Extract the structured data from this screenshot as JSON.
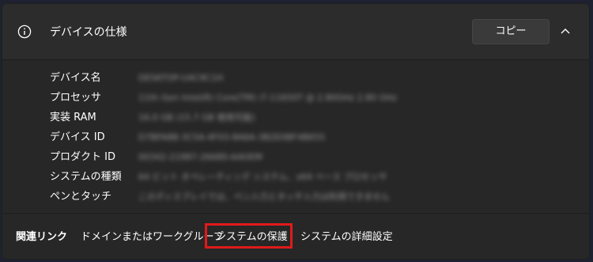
{
  "header": {
    "title": "デバイスの仕様",
    "copy_label": "コピー"
  },
  "specs": [
    {
      "label": "デバイス名",
      "value": "DESKTOP-U4C9C1H"
    },
    {
      "label": "プロセッサ",
      "value": "11th Gen Intel(R) Core(TM) i7-11650T @ 2.80GHz   2.80 GHz"
    },
    {
      "label": "実装 RAM",
      "value": "16.0 GB (15.7 GB 使用可能)"
    },
    {
      "label": "デバイス ID",
      "value": "D7BFA8B-3C5A-4F03-8A6A-3B2E0BF4B655"
    },
    {
      "label": "プロダクト ID",
      "value": "00342-21987-26680-AAOEM"
    },
    {
      "label": "システムの種類",
      "value": "64 ビット オペレーティング システム、x64 ベース プロセッサ"
    },
    {
      "label": "ペンとタッチ",
      "value": "このディスプレイでは、ペン入力とタッチ入力は利用できません"
    }
  ],
  "related": {
    "label": "関連リンク",
    "links": [
      "ドメインまたはワークグループ",
      "システムの保護",
      "システムの詳細設定"
    ]
  },
  "colors": {
    "highlight": "#e01a1a",
    "panel": "#272727",
    "header": "#2c2c2c"
  },
  "icons": [
    "info-icon",
    "chevron-up-icon"
  ]
}
